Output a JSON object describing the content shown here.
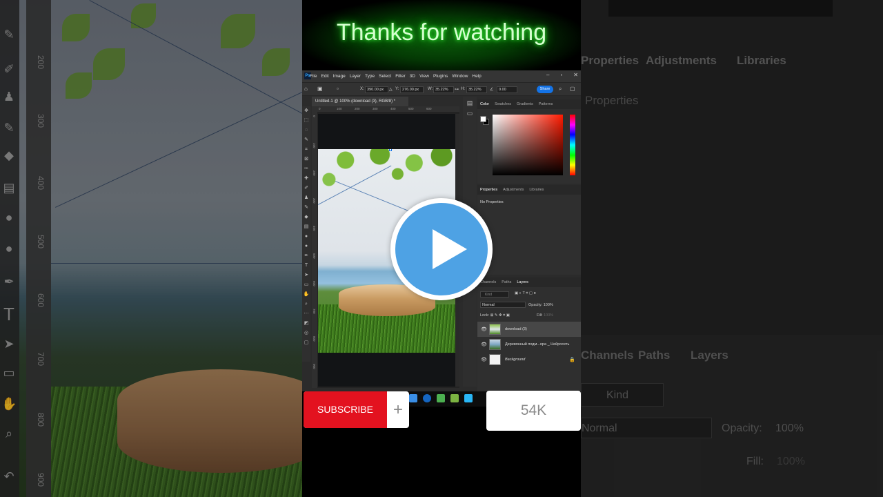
{
  "overlay": {
    "title": "Thanks for watching",
    "subscribe_label": "SUBSCRIBE",
    "plus_glyph": "+",
    "subscriber_count": "54K"
  },
  "ps": {
    "menu": [
      "File",
      "Edit",
      "Image",
      "Layer",
      "Type",
      "Select",
      "Filter",
      "3D",
      "View",
      "Plugins",
      "Window",
      "Help"
    ],
    "options": {
      "x_value": "390.00 px",
      "y_value": "276.00 px",
      "w_value": "35.22%",
      "h_value": "35.22%",
      "angle_value": "0.00",
      "share_label": "Share"
    },
    "doc_tab": "Untitled-1 @ 100% (download (3), RGB/8) *",
    "ruler_h": [
      "0",
      "100",
      "200",
      "300",
      "400",
      "500",
      "600"
    ],
    "ruler_v": [
      "0",
      "100",
      "200",
      "300",
      "400",
      "500",
      "600",
      "700",
      "800",
      "900"
    ],
    "color_tabs": [
      "Color",
      "Swatches",
      "Gradients",
      "Patterns"
    ],
    "props_tabs": [
      "Properties",
      "Adjustments",
      "Libraries"
    ],
    "no_properties": "No Properties",
    "layers_tabs": [
      "Channels",
      "Paths",
      "Layers"
    ],
    "search_placeholder": "Kind",
    "blend_mode": "Normal",
    "opacity_label": "Opacity:",
    "opacity_value": "100%",
    "lock_label": "Lock:",
    "fill_label": "Fill:",
    "fill_value": "100%",
    "layers": [
      {
        "name": "download (3)"
      },
      {
        "name": "Деревянный подм...ора _ Нейросеть"
      },
      {
        "name": "Background"
      }
    ]
  },
  "bg_right": {
    "tabs": [
      "Properties",
      "Adjustments",
      "Libraries"
    ],
    "properties_text": "Properties",
    "lower_tabs": [
      "Channels",
      "Paths",
      "Layers"
    ],
    "search_placeholder": "Kind",
    "blend_mode": "Normal",
    "opacity_label": "Opacity:",
    "opacity_value": "100%",
    "fill_label": "Fill:",
    "fill_value": "100%"
  },
  "bg_left": {
    "ruler": [
      "200",
      "300",
      "400",
      "500",
      "600",
      "700",
      "800",
      "900"
    ]
  },
  "colors": {
    "play": "#4ea2e4",
    "subscribe_red": "#e3121f",
    "title_glow": "#3bff3b",
    "ps_accent": "#1473e6"
  }
}
